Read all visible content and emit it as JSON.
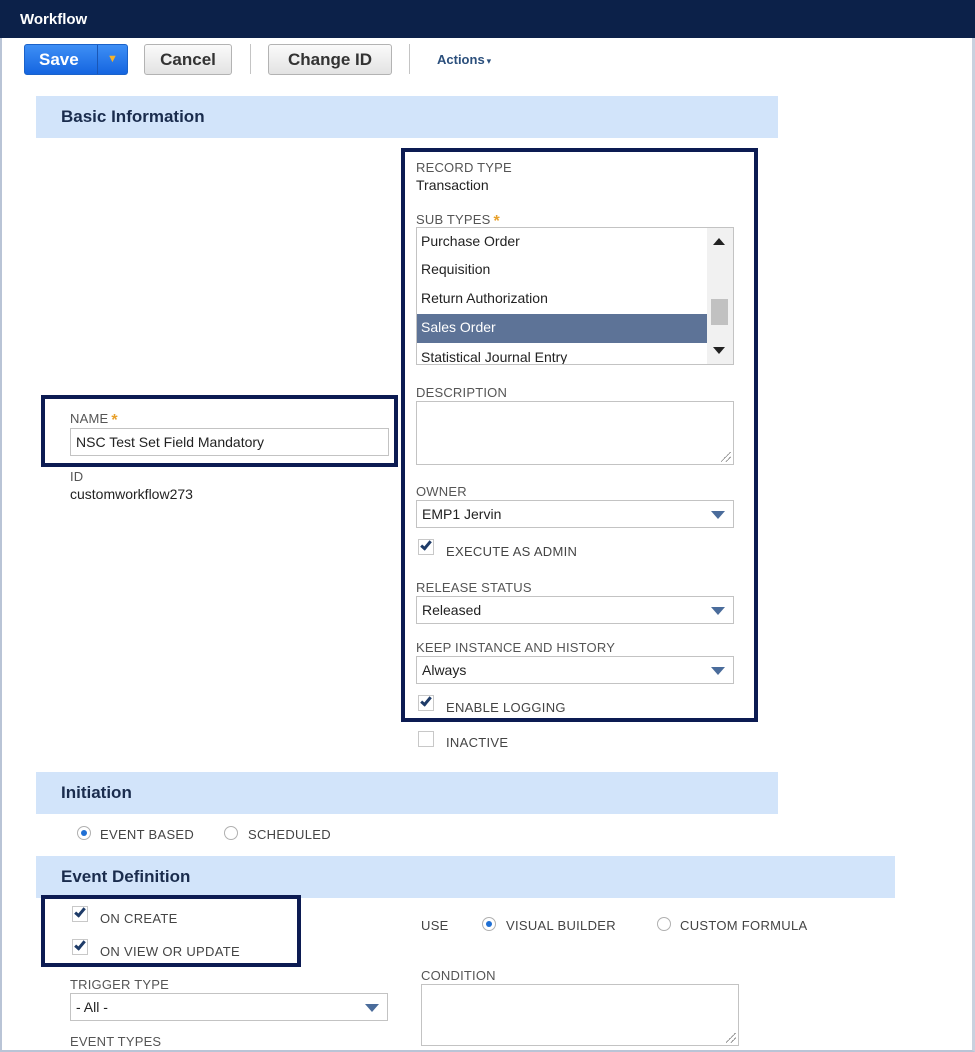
{
  "window": {
    "title": "Workflow"
  },
  "toolbar": {
    "save_label": "Save",
    "save_menu_glyph": "▼",
    "cancel_label": "Cancel",
    "change_id_label": "Change ID",
    "actions_label": "Actions",
    "actions_glyph": "▾"
  },
  "sections": {
    "basic_information": "Basic Information",
    "initiation": "Initiation",
    "event_definition": "Event Definition"
  },
  "required_marker": "*",
  "name": {
    "label": "NAME",
    "value": "NSC Test Set Field Mandatory"
  },
  "id": {
    "label": "ID",
    "value": "customworkflow273"
  },
  "record_type": {
    "label": "RECORD TYPE",
    "value": "Transaction"
  },
  "sub_types": {
    "label": "SUB TYPES",
    "items": [
      "Purchase Order",
      "Requisition",
      "Return Authorization",
      "Sales Order",
      "Statistical Journal Entry"
    ],
    "selected": "Sales Order"
  },
  "description": {
    "label": "DESCRIPTION",
    "value": ""
  },
  "owner": {
    "label": "OWNER",
    "value": "EMP1 Jervin"
  },
  "execute_as_admin": {
    "label": "EXECUTE AS ADMIN",
    "checked": true
  },
  "release_status": {
    "label": "RELEASE STATUS",
    "value": "Released"
  },
  "keep_instance": {
    "label": "KEEP INSTANCE AND HISTORY",
    "value": "Always"
  },
  "enable_logging": {
    "label": "ENABLE LOGGING",
    "checked": true
  },
  "inactive": {
    "label": "INACTIVE",
    "checked": false
  },
  "initiation": {
    "options": [
      "EVENT BASED",
      "SCHEDULED"
    ],
    "selected": "EVENT BASED"
  },
  "event_definition": {
    "on_create": {
      "label": "ON CREATE",
      "checked": true
    },
    "on_view_or_update": {
      "label": "ON VIEW OR UPDATE",
      "checked": true
    },
    "use_label": "USE",
    "use_options": [
      "VISUAL BUILDER",
      "CUSTOM FORMULA"
    ],
    "use_selected": "VISUAL BUILDER",
    "trigger_type": {
      "label": "TRIGGER TYPE",
      "value": "- All -"
    },
    "condition": {
      "label": "CONDITION",
      "value": ""
    },
    "event_types": {
      "label": "EVENT TYPES"
    }
  },
  "colors": {
    "title_bar": "#0c2149",
    "section_header": "#d2e4fa",
    "save_button": "#1565e0",
    "highlight_border": "#0c1b52",
    "selected_item": "#5d7397",
    "required_asterisk": "#e8a02b"
  }
}
